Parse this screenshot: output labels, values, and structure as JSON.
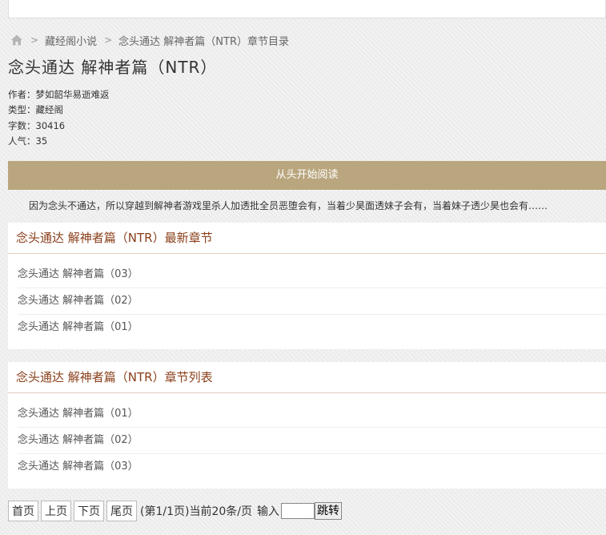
{
  "breadcrumb": {
    "home_icon": "home-icon",
    "items": [
      "藏经阁小说",
      "念头通达 解神者篇（NTR）章节目录"
    ]
  },
  "book": {
    "title": "念头通达 解神者篇（NTR）",
    "author": "作者：梦如韶华易逝难返",
    "type": "类型：藏经阁",
    "words": "字数：30416",
    "popularity": "人气：35"
  },
  "read_button": "从头开始阅读",
  "description": "因为念头不通达，所以穿越到解神者游戏里杀人加透批全员恶堕会有，当着少昊面透妹子会有，当着妹子透少昊也会有……",
  "latest": {
    "heading": "念头通达 解神者篇（NTR）最新章节",
    "chapters": [
      "念头通达 解神者篇（03）",
      "念头通达 解神者篇（02）",
      "念头通达 解神者篇（01）"
    ]
  },
  "list": {
    "heading": "念头通达 解神者篇（NTR）章节列表",
    "chapters": [
      "念头通达 解神者篇（01）",
      "念头通达 解神者篇（02）",
      "念头通达 解神者篇（03）"
    ]
  },
  "pager": {
    "first": "首页",
    "prev": "上页",
    "next": "下页",
    "last": "尾页",
    "info": "(第1/1页)当前20条/页",
    "input_label": "输入",
    "input_value": "",
    "go": "跳转"
  },
  "colors": {
    "accent": "#b9a67e",
    "heading": "#8a3f1a"
  }
}
